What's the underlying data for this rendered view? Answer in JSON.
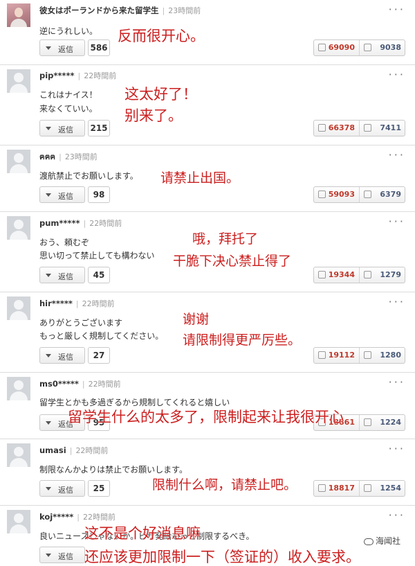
{
  "comments": [
    {
      "user": "彼女はポーランドから来た留学生",
      "time": "23時間前",
      "lines": [
        "逆にうれしい。"
      ],
      "reply_label": "返信",
      "reply_count": "586",
      "up": "69090",
      "down": "9038",
      "annotations": [
        "反而很开心。"
      ]
    },
    {
      "user": "pip*****",
      "time": "22時間前",
      "lines": [
        "これはナイス！",
        "来なくていい。"
      ],
      "reply_label": "返信",
      "reply_count": "215",
      "up": "66378",
      "down": "7411",
      "annotations": [
        "这太好了！",
        "别来了。"
      ]
    },
    {
      "user": "ฅฅฅ",
      "time": "23時間前",
      "lines": [
        "渡航禁止でお願いします。"
      ],
      "reply_label": "返信",
      "reply_count": "98",
      "up": "59093",
      "down": "6379",
      "annotations": [
        "请禁止出国。"
      ]
    },
    {
      "user": "pum*****",
      "time": "22時間前",
      "lines": [
        "おう、頼むぞ",
        "思い切って禁止しても構わない"
      ],
      "reply_label": "返信",
      "reply_count": "45",
      "up": "19344",
      "down": "1279",
      "annotations": [
        "哦，拜托了",
        "干脆下决心禁止得了"
      ]
    },
    {
      "user": "hir*****",
      "time": "22時間前",
      "lines": [
        "ありがとうございます",
        "もっと厳しく規制してください。"
      ],
      "reply_label": "返信",
      "reply_count": "27",
      "up": "19112",
      "down": "1280",
      "annotations": [
        "谢谢",
        "请限制得更严厉些。"
      ]
    },
    {
      "user": "ms0*****",
      "time": "22時間前",
      "lines": [
        "留学生とかも多過ぎるから規制してくれると嬉しい"
      ],
      "reply_label": "返信",
      "reply_count": "95",
      "up": "18861",
      "down": "1224",
      "annotations": [
        "留学生什么的太多了，限制起来让我很开心"
      ]
    },
    {
      "user": "umasi",
      "time": "22時間前",
      "lines": [
        "制限なんかよりは禁止でお願いします。"
      ],
      "reply_label": "返信",
      "reply_count": "25",
      "up": "18817",
      "down": "1254",
      "annotations": [
        "限制什么啊，请禁止吧。"
      ]
    },
    {
      "user": "koj*****",
      "time": "22時間前",
      "lines": [
        "良いニュースじゃないか。ビザ発給もっと制限するべき。"
      ],
      "reply_label": "返信",
      "reply_count": "",
      "up": "",
      "down": "",
      "annotations": [
        "这不是个好消息嘛",
        "还应该更加限制一下（签证的）收入要求。"
      ]
    }
  ],
  "watermark": "海闻社",
  "icons": {
    "avatar": "avatar-placeholder-icon",
    "menu": "more-options-icon",
    "reply": "caret-down-icon",
    "up": "thumbs-up-icon",
    "down": "thumbs-down-icon"
  },
  "colors": {
    "annotation": "#cc1f1f",
    "up_count": "#c0392b",
    "down_count": "#4a5a78"
  }
}
